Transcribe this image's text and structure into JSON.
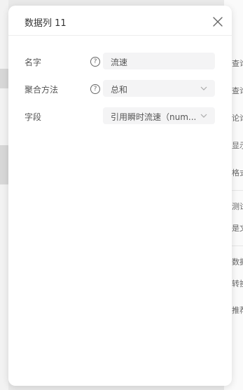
{
  "panel": {
    "title": "数据列 11"
  },
  "form": {
    "name_label": "名字",
    "name_value": "流速",
    "aggregate_label": "聚合方法",
    "aggregate_value": "总和",
    "field_label": "字段",
    "field_value": "引用瞬时流速（num..."
  },
  "background": {
    "right_items": [
      "查询",
      "查询",
      "论询",
      "显示",
      "格式",
      "测试",
      "是文",
      "数据",
      "转换",
      "推荐"
    ]
  },
  "icons": {
    "close": "close-icon",
    "help": "question-circle-icon",
    "dropdown": "chevron-down-icon"
  },
  "colors": {
    "panel_bg": "#ffffff",
    "field_bg": "#f4f4f5",
    "text": "#555555"
  }
}
